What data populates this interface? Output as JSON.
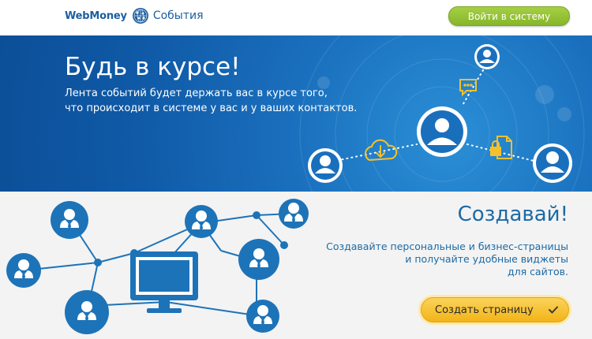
{
  "header": {
    "brand_name": "WebMoney",
    "brand_section": "События",
    "login_label": "Войти в систему",
    "logo_icon": "webmoney-globe-icon"
  },
  "hero": {
    "title": "Будь в курсе!",
    "text_line1": "Лента событий будет держать вас в курсе того,",
    "text_line2": "что происходит в системе у вас и у ваших контактов.",
    "icons": [
      "user-icon",
      "chat-bubble-icon",
      "cloud-download-icon",
      "locked-document-icon"
    ]
  },
  "create": {
    "title": "Создавай!",
    "text_line1": "Создавайте персональные и бизнес-страницы",
    "text_line2": "и получайте удобные виджеты",
    "text_line3": "для сайтов.",
    "button_label": "Создать страницу",
    "button_icon": "checkmark-icon"
  },
  "colors": {
    "hero_blue": "#1565b5",
    "accent_green": "#8ec232",
    "accent_yellow": "#f6c02a",
    "text_blue": "#1d6aa5",
    "network_blue": "#1d73b8"
  }
}
